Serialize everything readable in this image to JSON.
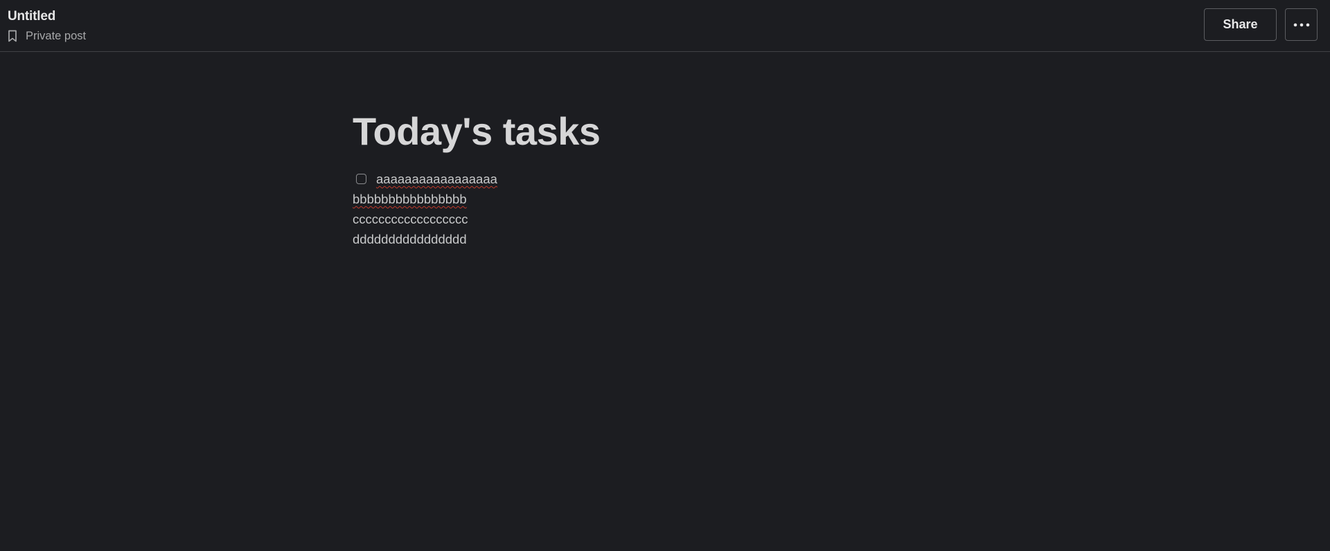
{
  "header": {
    "title": "Untitled",
    "privacy_label": "Private post",
    "share_label": "Share",
    "more_icon": "ellipsis-icon",
    "privacy_icon": "bookmark-icon"
  },
  "document": {
    "heading": "Today's tasks",
    "checklist_item": "aaaaaaaaaaaaaaaaa",
    "lines": [
      "bbbbbbbbbbbbbbbb",
      "cccccccccccccccccc",
      "dddddddddddddddd"
    ]
  },
  "colors": {
    "background": "#1c1d21",
    "divider": "#414246",
    "text": "#d1d2d3",
    "spellcheck": "#c0392b"
  }
}
